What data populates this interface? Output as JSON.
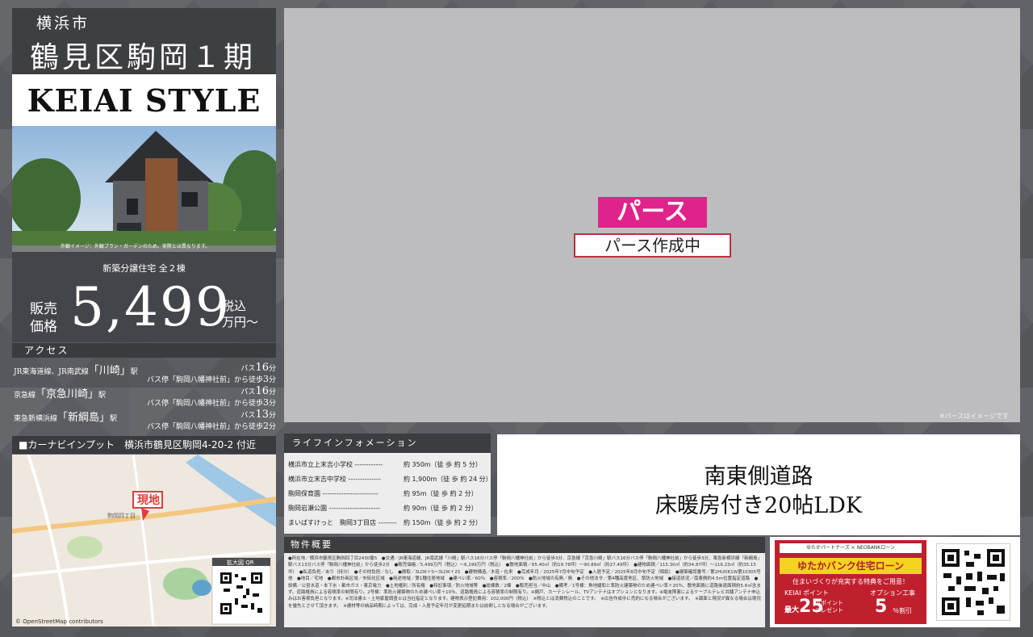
{
  "header": {
    "city": "横浜市",
    "title": "鶴見区駒岡１期",
    "brand": "KEIAI STYLE"
  },
  "hero_image": {
    "caption": "外観イメージ：外観プラン・ガーデンのため、実際とは異なります。"
  },
  "price": {
    "subtitle": "新築分譲住宅 全２棟",
    "label_1": "販売",
    "label_2": "価格",
    "amount": "5,499",
    "unit_1": "税込",
    "unit_2": "万円〜"
  },
  "access": {
    "heading": "アクセス",
    "lines": [
      {
        "line_pre": "JR東海道線、JR南武線",
        "station": "「川崎」",
        "line_post": "駅",
        "bus_pre": "バス",
        "bus_min": "16",
        "bus_post": "分",
        "walk_pre": "バス停「駒岡八幡神社前」から徒歩",
        "walk_min": "3",
        "walk_post": "分"
      },
      {
        "line_pre": "京急線",
        "station": "「京急川崎」",
        "line_post": "駅",
        "bus_pre": "バス",
        "bus_min": "16",
        "bus_post": "分",
        "walk_pre": "バス停「駒岡八幡神社前」から徒歩",
        "walk_min": "3",
        "walk_post": "分"
      },
      {
        "line_pre": "東急新横浜線",
        "station": "「新綱島」",
        "line_post": "駅",
        "bus_pre": "バス",
        "bus_min": "13",
        "bus_post": "分",
        "walk_pre": "バス停「駒岡八幡神社前」から徒歩",
        "walk_min": "2",
        "walk_post": "分"
      }
    ]
  },
  "address": {
    "label": "■カーナビインプット　横浜市鶴見区駒岡4-20-2 付近"
  },
  "map": {
    "site_label": "現地",
    "qr_label": "拡大図 QR",
    "credit": "© OpenStreetMap contributors",
    "area_label": "駒岡四丁目"
  },
  "perspective": {
    "badge": "パース",
    "status": "パース作成中",
    "note": "※パースはイメージです"
  },
  "life_info": {
    "heading": "ライフインフォメーション",
    "rows": [
      {
        "name": "横浜市立上末吉小学校 ------------",
        "dist": "約 350m（徒 歩 約 5 分）"
      },
      {
        "name": "横浜市立末吉中学校 --------------",
        "dist": "約 1,900m（徒 歩 約 24 分）"
      },
      {
        "name": "駒岡保育園 ------------------------",
        "dist": "約 95m（徒 歩 約 2 分）"
      },
      {
        "name": "駒岡岩瀬公園 ----------------------",
        "dist": "約 90m（徒 歩 約 2 分）"
      },
      {
        "name": "まいばすけっと　駒岡3丁目店 --------",
        "dist": "約 150m（徒 歩 約 2 分）"
      }
    ]
  },
  "features": {
    "line_1": "南東側道路",
    "line_2": "床暖房付き20帖LDK"
  },
  "property": {
    "heading": "物件概要",
    "text": "●所在地／横浜市鶴見区駒岡四丁目2430番5　●交通／JR東海道線、JR南武線「川崎」駅バス16分バス停「駒岡八幡神社前」から徒歩3分、京急線「京急川崎」駅バス16分バス停「駒岡八幡神社前」から徒歩3分、東急新横浜線「新綱島」駅バス13分バス停「駒岡八幡神社前」から徒歩2分　●販売価格／5,499万円（税込）〜6,199万円（税込）　●敷地面積／65.40㎡（約19.78坪）〜90.89㎡（約27.49坪）　●建物面積／115.30㎡（約34.87坪）〜116.23㎡（約35.15坪）　●私道負担／あり（持分）　●その他負担／なし　●間取／3LDK＋S〜3LDK＋2S　●建物構造／木造・在来　●完成年月／2025年7月中旬予定　●入居予定／2025年8月中旬予定（相談）　●建築確認番号／第2HUDK1W第10305号 他　●地目／宅地　●都市計画区域／市街化区域　●用途地域／第1種住居地域　●建ぺい率／60％　●容積率／200％　●防火地域の有無／無　●その他法令／第4種高度地区、準防火地域　●接道状況／南東側約4.5m位置指定道路　●設備／公営水道・本下水・都市ガス・東京電力　●土地権利／所有権　●特記事項／防火地域等　●総棟数／2棟　●販売担当／中山　●備考／1号棟：角地緩和と準防火建築物のため建ぺい率＋20％、敷地面積に道路後退面積約5.6㎡含まず。道路権員による容積率の制限有り。2号棟：準防火建築物のため建ぺい率＋10％、道路権員による容積率の制限有り。※網戸、カーテンレール、TVアンテナはオプションとなります。※電波障害によるケーブルテレビ共聴アンテナ申込みはお客様負担となります。※司法書士・土地家屋調査士は当社指定となります。建物表示登記費用：102,000円（税込）　※税込とは消費税込のことです。　※広告作成中に売約になる場合がございます。　※図面と現況が異なる場合は現況を優先とさせて頂きます。　※建材等の納品時期によっては、完成・入居予定年月が変更延期または前倒しとなる場合がございます。"
  },
  "loan": {
    "partner": "ゆたかパートナーズ × NEOBANKローン",
    "title": "ゆたかバンク住宅ローン",
    "subtitle": "住まいづくりが充実する特典をご用意！",
    "point_label": "KEIAI ポイント",
    "point_prefix": "最大",
    "point_value": "25",
    "point_unit_1": "万ポイント",
    "point_unit_2": "プレゼント",
    "option_label": "オプション工事",
    "option_value": "5",
    "option_unit": "％割引"
  },
  "colors": {
    "accent_pink": "#e0238a",
    "panel_dark": "#3e3f43",
    "loan_red": "#c0202e",
    "loan_yellow": "#f5d21f"
  }
}
